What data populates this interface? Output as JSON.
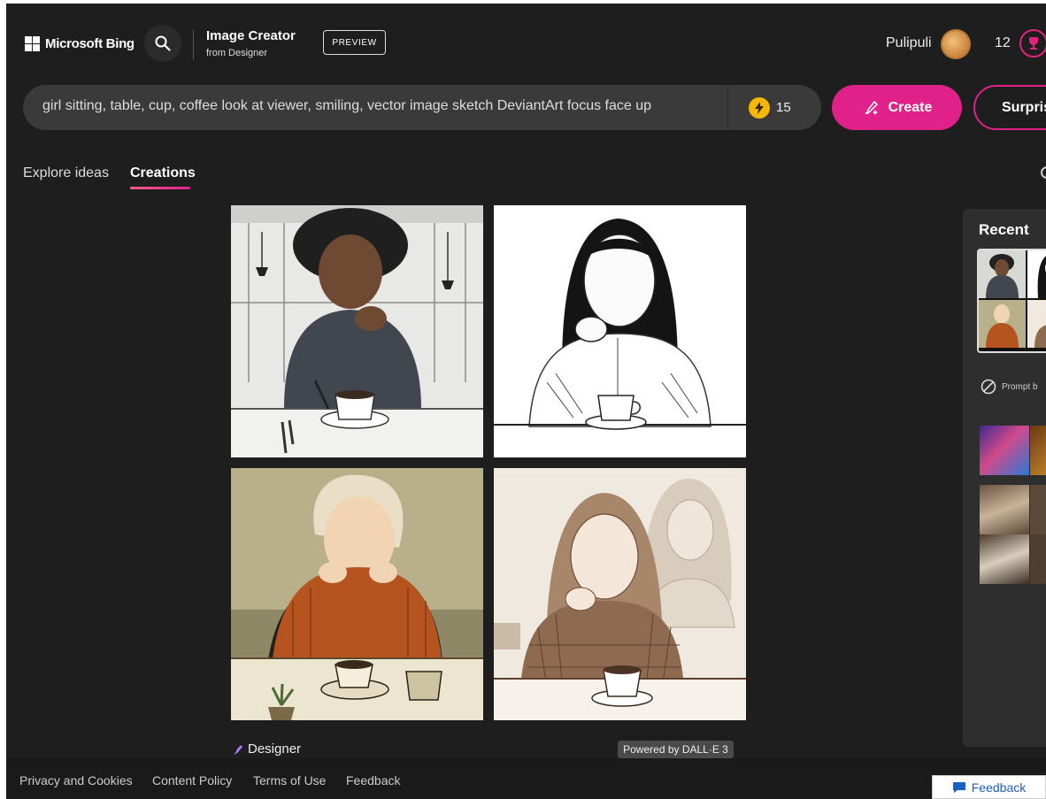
{
  "header": {
    "brand": "Microsoft Bing",
    "app_title": "Image Creator",
    "app_subtitle": "from Designer",
    "preview_badge": "PREVIEW",
    "user_name": "Pulipuli",
    "rewards_count": "12"
  },
  "prompt": {
    "value": "girl sitting, table, cup, coffee look at viewer, smiling, vector image  sketch DeviantArt focus face up",
    "boosts": "15",
    "create_label": "Create",
    "surprise_label": "Surprise Me"
  },
  "tabs": [
    {
      "label": "Explore ideas",
      "active": false
    },
    {
      "label": "Creations",
      "active": true
    }
  ],
  "results": {
    "designer_label": "Designer",
    "powered_by": "Powered by DALL·E 3"
  },
  "recent": {
    "title": "Recent",
    "prompt_chip": "Prompt b"
  },
  "footer": {
    "links": [
      "Privacy and Cookies",
      "Content Policy",
      "Terms of Use",
      "Feedback"
    ],
    "feedback_button": "Feedback"
  },
  "colors": {
    "accent": "#e0218a",
    "background": "#1e1e1e",
    "boost": "#f5b700"
  },
  "icons": [
    "microsoft-logo-icon",
    "search-icon",
    "reward-trophy-icon",
    "lightning-icon",
    "create-brush-icon",
    "designer-logo-icon",
    "blocked-icon",
    "feedback-chat-icon"
  ]
}
